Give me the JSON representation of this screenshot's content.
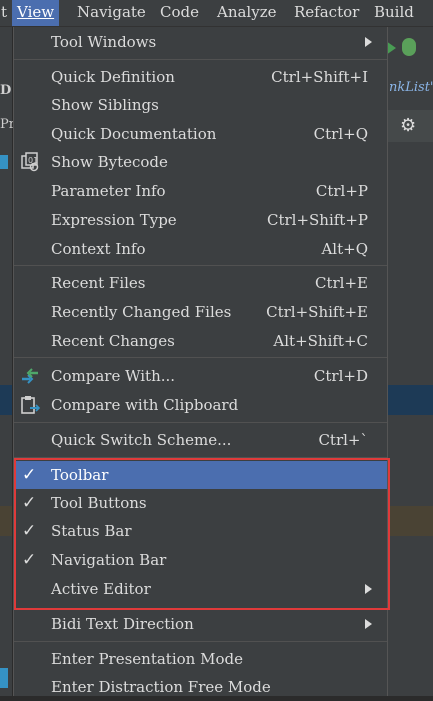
{
  "menubar": {
    "items": [
      {
        "label": "t",
        "mnemonic": ""
      },
      {
        "label": "View",
        "mnemonic": "V"
      },
      {
        "label": "Navigate",
        "mnemonic": "N"
      },
      {
        "label": "Code",
        "mnemonic": "C"
      },
      {
        "label": "Analyze",
        "mnemonic": "z"
      },
      {
        "label": "Refactor",
        "mnemonic": "R"
      },
      {
        "label": "Build",
        "mnemonic": "B"
      }
    ]
  },
  "background": {
    "tab_text": "nkList'",
    "left_letter_1": "D",
    "left_letter_2": "Pr",
    "left_letter_3": "I"
  },
  "menu": {
    "items": [
      {
        "label": "Tool Windows",
        "shortcut": "",
        "submenu": true
      },
      {
        "label": "Quick Definition",
        "shortcut": "Ctrl+Shift+I"
      },
      {
        "label": "Show Siblings",
        "shortcut": ""
      },
      {
        "label": "Quick Documentation",
        "shortcut": "Ctrl+Q"
      },
      {
        "label": "Show Bytecode",
        "shortcut": "",
        "icon": "bytecode-icon"
      },
      {
        "label": "Parameter Info",
        "shortcut": "Ctrl+P"
      },
      {
        "label": "Expression Type",
        "shortcut": "Ctrl+Shift+P"
      },
      {
        "label": "Context Info",
        "shortcut": "Alt+Q"
      },
      {
        "label": "Recent Files",
        "shortcut": "Ctrl+E"
      },
      {
        "label": "Recently Changed Files",
        "shortcut": "Ctrl+Shift+E"
      },
      {
        "label": "Recent Changes",
        "shortcut": "Alt+Shift+C"
      },
      {
        "label": "Compare With...",
        "shortcut": "Ctrl+D",
        "icon": "compare-icon"
      },
      {
        "label": "Compare with Clipboard",
        "shortcut": "",
        "icon": "compare-clipboard-icon"
      },
      {
        "label": "Quick Switch Scheme...",
        "shortcut": "Ctrl+`"
      },
      {
        "label": "Toolbar",
        "shortcut": "",
        "checked": true,
        "selected": true
      },
      {
        "label": "Tool Buttons",
        "shortcut": "",
        "checked": true
      },
      {
        "label": "Status Bar",
        "shortcut": "",
        "checked": true
      },
      {
        "label": "Navigation Bar",
        "shortcut": "",
        "checked": true
      },
      {
        "label": "Active Editor",
        "shortcut": "",
        "submenu": true
      },
      {
        "label": "Bidi Text Direction",
        "shortcut": "",
        "submenu": true
      },
      {
        "label": "Enter Presentation Mode",
        "shortcut": ""
      },
      {
        "label": "Enter Distraction Free Mode",
        "shortcut": ""
      }
    ]
  },
  "check_glyph": "✓",
  "colors": {
    "menu_bg": "#3c3f41",
    "selection": "#4b6eaf",
    "highlight_border": "#e03a3a"
  }
}
